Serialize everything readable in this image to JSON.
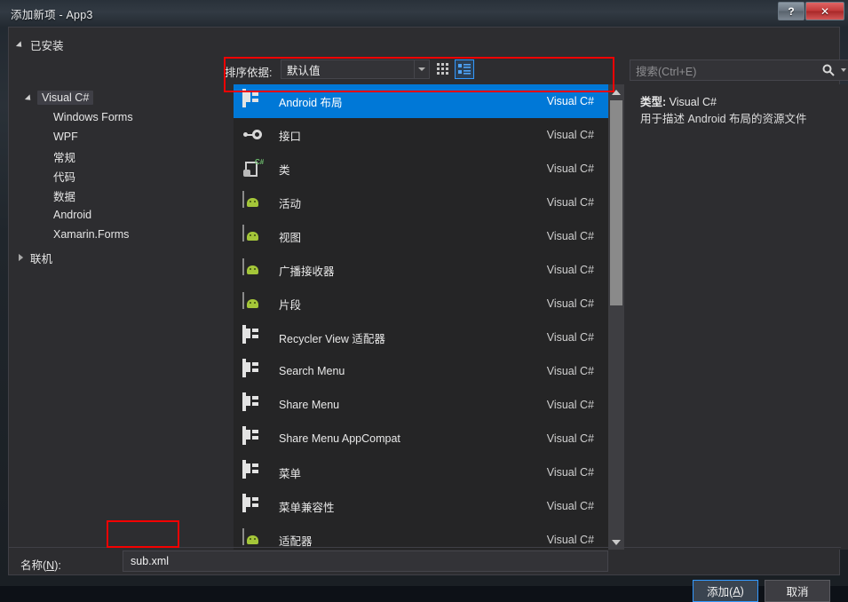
{
  "window": {
    "title": "添加新项 - App3",
    "help_button": "?",
    "close_button": "✕"
  },
  "tree": {
    "root_label": "已安装",
    "items": [
      {
        "label": "Visual C#",
        "level": 1,
        "state": "open",
        "selected": true
      },
      {
        "label": "Windows Forms",
        "level": 2,
        "state": "leaf",
        "selected": false
      },
      {
        "label": "WPF",
        "level": 2,
        "state": "leaf",
        "selected": false
      },
      {
        "label": "常规",
        "level": 2,
        "state": "leaf",
        "selected": false
      },
      {
        "label": "代码",
        "level": 2,
        "state": "leaf",
        "selected": false
      },
      {
        "label": "数据",
        "level": 2,
        "state": "leaf",
        "selected": false
      },
      {
        "label": "Android",
        "level": 2,
        "state": "leaf",
        "selected": false
      },
      {
        "label": "Xamarin.Forms",
        "level": 2,
        "state": "leaf",
        "selected": false
      },
      {
        "label": "联机",
        "level": 1,
        "state": "closed",
        "selected": false
      }
    ]
  },
  "toolbar": {
    "sort_label": "排序依据:",
    "sort_value": "默认值",
    "grid_view_icon": "grid-view-icon",
    "list_view_icon": "list-view-icon"
  },
  "search": {
    "placeholder": "搜索(Ctrl+E)",
    "icon": "search-icon",
    "dropdown_icon": "chevron-down-icon"
  },
  "list": {
    "language_column": "Visual C#",
    "items": [
      {
        "name": "Android 布局",
        "lang": "Visual C#",
        "icon": "layout-icon",
        "selected": true
      },
      {
        "name": "接口",
        "lang": "Visual C#",
        "icon": "interface-icon",
        "selected": false
      },
      {
        "name": "类",
        "lang": "Visual C#",
        "icon": "class-icon",
        "selected": false
      },
      {
        "name": "活动",
        "lang": "Visual C#",
        "icon": "android-icon",
        "selected": false
      },
      {
        "name": "视图",
        "lang": "Visual C#",
        "icon": "android-icon",
        "selected": false
      },
      {
        "name": "广播接收器",
        "lang": "Visual C#",
        "icon": "android-icon",
        "selected": false
      },
      {
        "name": "片段",
        "lang": "Visual C#",
        "icon": "android-icon",
        "selected": false
      },
      {
        "name": "Recycler View 适配器",
        "lang": "Visual C#",
        "icon": "layout-icon",
        "selected": false
      },
      {
        "name": "Search Menu",
        "lang": "Visual C#",
        "icon": "layout-icon",
        "selected": false
      },
      {
        "name": "Share Menu",
        "lang": "Visual C#",
        "icon": "layout-icon",
        "selected": false
      },
      {
        "name": "Share Menu AppCompat",
        "lang": "Visual C#",
        "icon": "layout-icon",
        "selected": false
      },
      {
        "name": "菜单",
        "lang": "Visual C#",
        "icon": "layout-icon",
        "selected": false
      },
      {
        "name": "菜单兼容性",
        "lang": "Visual C#",
        "icon": "layout-icon",
        "selected": false
      },
      {
        "name": "适配器",
        "lang": "Visual C#",
        "icon": "android-icon",
        "selected": false
      }
    ]
  },
  "details": {
    "type_label": "类型:",
    "type_value": "Visual C#",
    "description": "用于描述 Android 布局的资源文件"
  },
  "footer": {
    "name_label_pre": "名称(",
    "name_label_key": "N",
    "name_label_post": "):",
    "name_value": "sub.xml",
    "add_pre": "添加(",
    "add_key": "A",
    "add_post": ")",
    "cancel_label": "取消"
  },
  "colors": {
    "accent": "#0078d7",
    "annotation": "#f40000",
    "panel_bg": "#2d2d30",
    "list_bg": "#252526",
    "close_button": "#c23a3a"
  }
}
